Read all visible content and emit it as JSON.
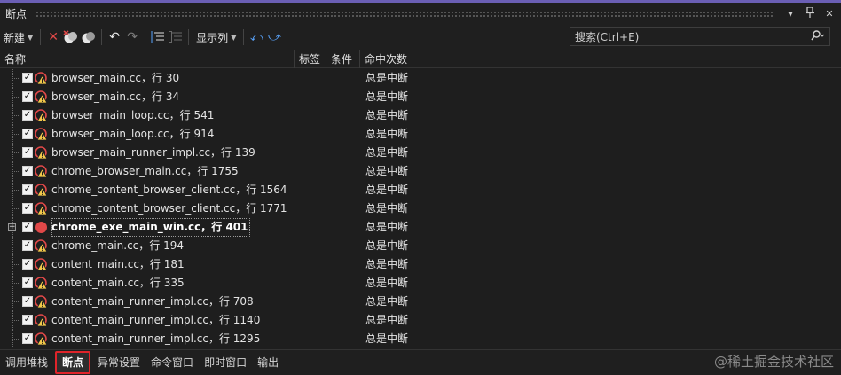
{
  "window": {
    "title": "断点",
    "menu_icon": "▾",
    "pin_icon": "📌",
    "close_icon": "✕"
  },
  "toolbar": {
    "new_label": "新建",
    "columns_label": "显示列",
    "delete_icon": "✕",
    "undo_icon": "↶",
    "redo_icon": "↷",
    "link_left_icon": "⤺",
    "link_right_icon": "⤻"
  },
  "search": {
    "placeholder": "搜索(Ctrl+E)",
    "icon": "⚲"
  },
  "columns": {
    "name": "名称",
    "tag": "标签",
    "condition": "条件",
    "hit_count": "命中次数"
  },
  "rows": [
    {
      "name": "browser_main.cc，行 30",
      "hits": "总是中断",
      "icon": "warning"
    },
    {
      "name": "browser_main.cc，行 34",
      "hits": "总是中断",
      "icon": "warning"
    },
    {
      "name": "browser_main_loop.cc，行 541",
      "hits": "总是中断",
      "icon": "warning"
    },
    {
      "name": "browser_main_loop.cc，行 914",
      "hits": "总是中断",
      "icon": "warning"
    },
    {
      "name": "browser_main_runner_impl.cc，行 139",
      "hits": "总是中断",
      "icon": "warning"
    },
    {
      "name": "chrome_browser_main.cc，行 1755",
      "hits": "总是中断",
      "icon": "warning"
    },
    {
      "name": "chrome_content_browser_client.cc，行 1564",
      "hits": "总是中断",
      "icon": "warning"
    },
    {
      "name": "chrome_content_browser_client.cc，行 1771",
      "hits": "总是中断",
      "icon": "warning"
    },
    {
      "name": "chrome_exe_main_win.cc，行 401",
      "hits": "总是中断",
      "icon": "active"
    },
    {
      "name": "chrome_main.cc，行 194",
      "hits": "总是中断",
      "icon": "warning"
    },
    {
      "name": "content_main.cc，行 181",
      "hits": "总是中断",
      "icon": "warning"
    },
    {
      "name": "content_main.cc，行 335",
      "hits": "总是中断",
      "icon": "warning"
    },
    {
      "name": "content_main_runner_impl.cc，行 708",
      "hits": "总是中断",
      "icon": "warning"
    },
    {
      "name": "content_main_runner_impl.cc，行 1140",
      "hits": "总是中断",
      "icon": "warning"
    },
    {
      "name": "content_main_runner_impl.cc，行 1295",
      "hits": "总是中断",
      "icon": "warning"
    }
  ],
  "bottom_tabs": [
    "调用堆栈",
    "断点",
    "异常设置",
    "命令窗口",
    "即时窗口",
    "输出"
  ],
  "watermark": "@稀土掘金技术社区",
  "colors": {
    "accent": "#6b5fb5",
    "breakpoint_red": "#e04848",
    "active_tab_border": "#e0242a"
  }
}
